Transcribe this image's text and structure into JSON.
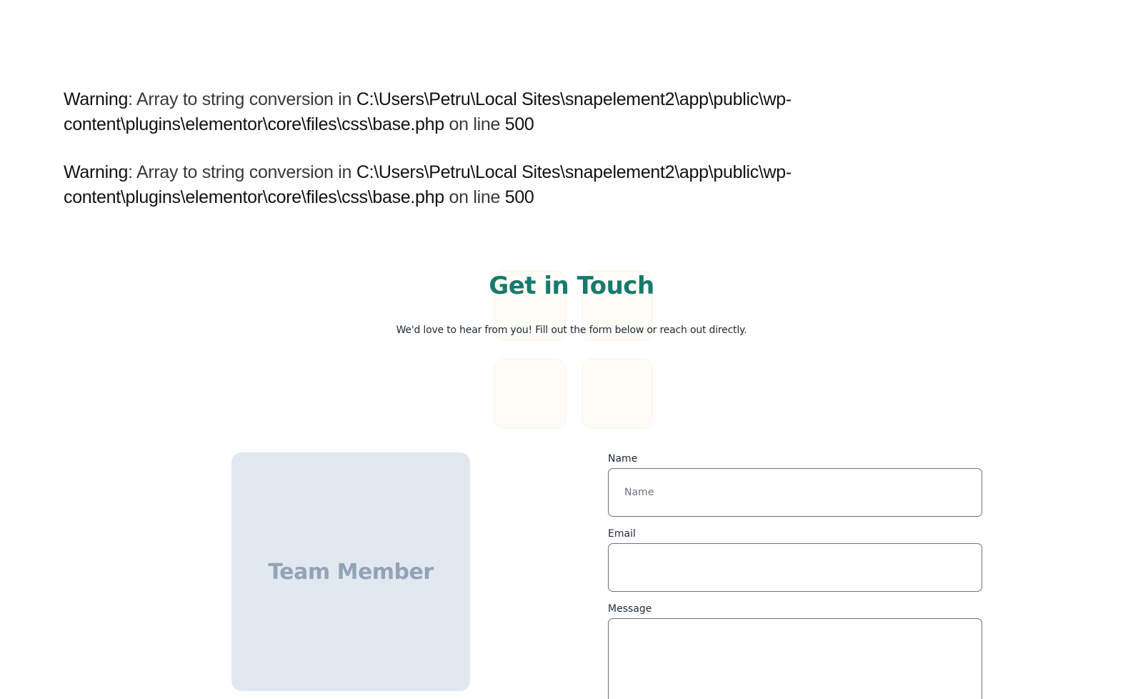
{
  "warnings": [
    {
      "label": "Warning",
      "separator": ": ",
      "message": "Array to string conversion in ",
      "path": "C:\\Users\\Petru\\Local Sites\\snapelement2\\app\\public\\wp-content\\plugins\\elementor\\core\\files\\css\\base.php",
      "line_text": " on line ",
      "line_number": "500"
    },
    {
      "label": "Warning",
      "separator": ": ",
      "message": "Array to string conversion in ",
      "path": "C:\\Users\\Petru\\Local Sites\\snapelement2\\app\\public\\wp-content\\plugins\\elementor\\core\\files\\css\\base.php",
      "line_text": " on line ",
      "line_number": "500"
    }
  ],
  "contact": {
    "title": "Get in Touch",
    "subtitle": "We'd love to hear from you! Fill out the form below or reach out directly."
  },
  "team_card": {
    "label": "Team Member"
  },
  "form": {
    "name_label": "Name",
    "name_placeholder": "Name",
    "email_label": "Email",
    "email_placeholder": "",
    "message_label": "Message",
    "message_placeholder": ""
  },
  "colors": {
    "heading": "#177a6d",
    "card_bg": "#e2e8f0",
    "card_text": "#94a3b8",
    "input_border": "#6b7280"
  }
}
